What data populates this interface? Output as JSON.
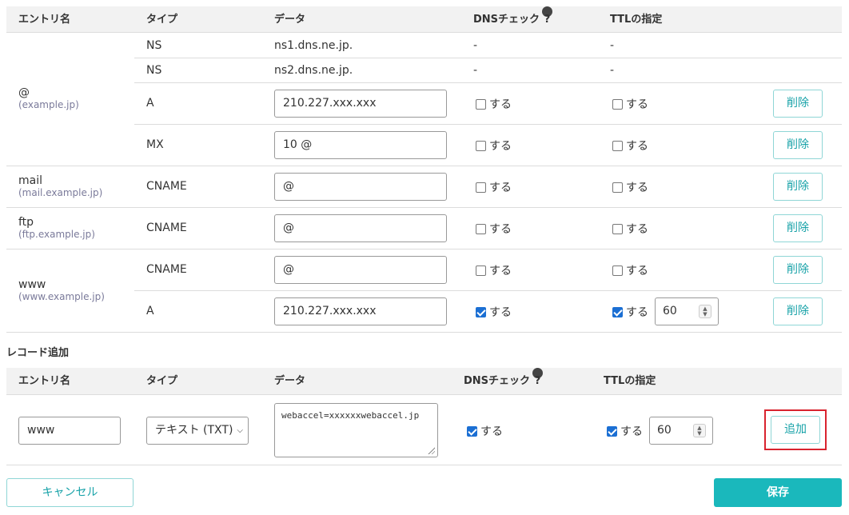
{
  "header": {
    "entry": "エントリ名",
    "type": "タイプ",
    "data": "データ",
    "dns_check": "DNSチェック",
    "ttl": "TTLの指定"
  },
  "check_label": "する",
  "delete_label": "削除",
  "entries": {
    "root": {
      "name": "@",
      "sub": "(example.jp)"
    },
    "mail": {
      "name": "mail",
      "sub": "(mail.example.jp)"
    },
    "ftp": {
      "name": "ftp",
      "sub": "(ftp.example.jp)"
    },
    "www": {
      "name": "www",
      "sub": "(www.example.jp)"
    }
  },
  "records": [
    {
      "type": "NS",
      "data": "ns1.dns.ne.jp.",
      "dns": "-",
      "ttl": "-"
    },
    {
      "type": "NS",
      "data": "ns2.dns.ne.jp.",
      "dns": "-",
      "ttl": "-"
    },
    {
      "type": "A",
      "data": "210.227.xxx.xxx",
      "dns_checked": false,
      "ttl_checked": false
    },
    {
      "type": "MX",
      "data": "10 @",
      "dns_checked": false,
      "ttl_checked": false
    },
    {
      "type": "CNAME",
      "data": "@",
      "dns_checked": false,
      "ttl_checked": false
    },
    {
      "type": "CNAME",
      "data": "@",
      "dns_checked": false,
      "ttl_checked": false
    },
    {
      "type": "CNAME",
      "data": "@",
      "dns_checked": false,
      "ttl_checked": false
    },
    {
      "type": "A",
      "data": "210.227.xxx.xxx",
      "dns_checked": true,
      "ttl_checked": true,
      "ttl_value": "60"
    }
  ],
  "add_record": {
    "title": "レコード追加",
    "entry_value": "www",
    "type_value": "テキスト (TXT)",
    "data_value": "webaccel=xxxxxxwebaccel.jp",
    "dns_checked": true,
    "ttl_checked": true,
    "ttl_value": "60",
    "add_label": "追加"
  },
  "footer": {
    "cancel_label": "キャンセル",
    "save_label": "保存"
  },
  "colors": {
    "accent": "#1ab8bc",
    "checkbox": "#1b6fd3",
    "highlight": "#d9232e"
  },
  "icons": {
    "help": "question-circle-icon"
  }
}
